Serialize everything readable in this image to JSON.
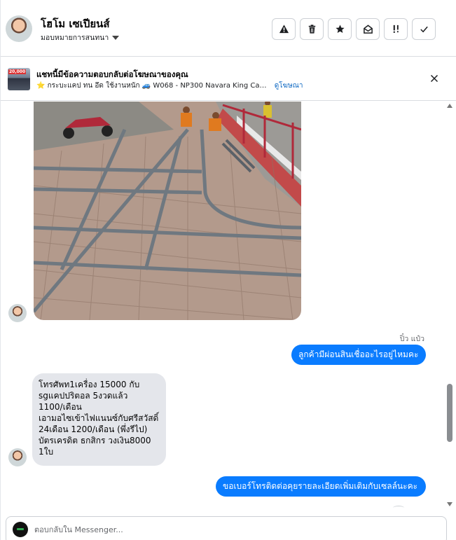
{
  "header": {
    "name": "โฮโม เซเปียนส์",
    "assign_label": "มอบหมายการสนทนา",
    "actions": [
      {
        "icon": "warning-icon"
      },
      {
        "icon": "trash-icon"
      },
      {
        "icon": "star-icon"
      },
      {
        "icon": "mark-unread-icon"
      },
      {
        "icon": "follow-up-icon"
      },
      {
        "icon": "check-icon"
      }
    ]
  },
  "ad_banner": {
    "thumb_tag": "20,000",
    "title": "แชทนี้มีข้อความตอบกลับต่อโฆษณาของคุณ",
    "subtitle": "⭐ กระบะแคป ทน อึด ใช้งานหนัก 🚙 W068 - NP300 Navara King Ca…",
    "link": "ดูโฆษณา"
  },
  "conversation": {
    "outgoing_sender": "ปิ๋ว แป๋ว",
    "messages": [
      {
        "direction": "outgoing",
        "text": "ลูกค้ามีผ่อนสินเชื่ออะไรอยู่ไหมคะ"
      },
      {
        "direction": "incoming",
        "text": "โทรศัพท1เครื่อง 15000 กับ\nsgแคปปริตอล 5งวดแล้ว\n 1100/เดือน\nเอามอไซเข้าไฟแนนซ์กับศรีสวัสดิ์\n 24เดือน 1200/เดือน (พึ่งรีไป)\nบัตรเครดิต ธกสิกร วงเงิน8000\n1ใบ"
      },
      {
        "direction": "outgoing",
        "text": "ขอเบอร์โทรติดต่อคุยรายละเอียดเพิ่มเติมกับเซลล์นะคะ"
      }
    ]
  },
  "composer": {
    "placeholder": "ตอบกลับใน Messenger..."
  },
  "colors": {
    "outgoing_bubble": "#0a7cff",
    "incoming_bubble": "#e4e6eb",
    "link": "#0a66c2"
  }
}
